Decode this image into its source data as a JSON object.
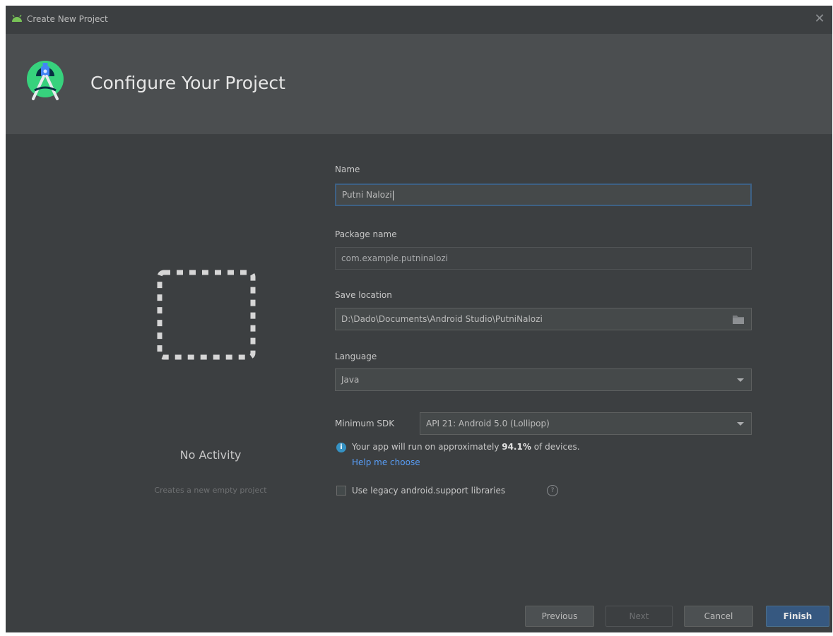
{
  "window": {
    "title": "Create New Project",
    "close_glyph": "✕"
  },
  "header": {
    "heading": "Configure Your Project"
  },
  "template": {
    "name": "No Activity",
    "description": "Creates a new empty project"
  },
  "form": {
    "name_label": "Name",
    "name_value": "Putni Nalozi",
    "package_label": "Package name",
    "package_value": "com.example.putninalozi",
    "location_label": "Save location",
    "location_value": "D:\\Dado\\Documents\\Android Studio\\PutniNalozi",
    "language_label": "Language",
    "language_value": "Java",
    "sdk_label": "Minimum SDK",
    "sdk_value": "API 21: Android 5.0 (Lollipop)",
    "info_prefix": "Your app will run on approximately ",
    "info_percent": "94.1%",
    "info_suffix": " of devices.",
    "help_link": "Help me choose",
    "legacy_label": "Use legacy android.support libraries",
    "legacy_checked": false
  },
  "buttons": {
    "previous": "Previous",
    "next": "Next",
    "cancel": "Cancel",
    "finish": "Finish"
  },
  "icons": {
    "app": "android-icon",
    "logo": "android-studio-logo",
    "folder": "folder-icon",
    "info": "info-icon",
    "help": "help-icon"
  },
  "colors": {
    "accent_link": "#589df6",
    "primary_button": "#365880",
    "focus_border": "#3d6185"
  }
}
